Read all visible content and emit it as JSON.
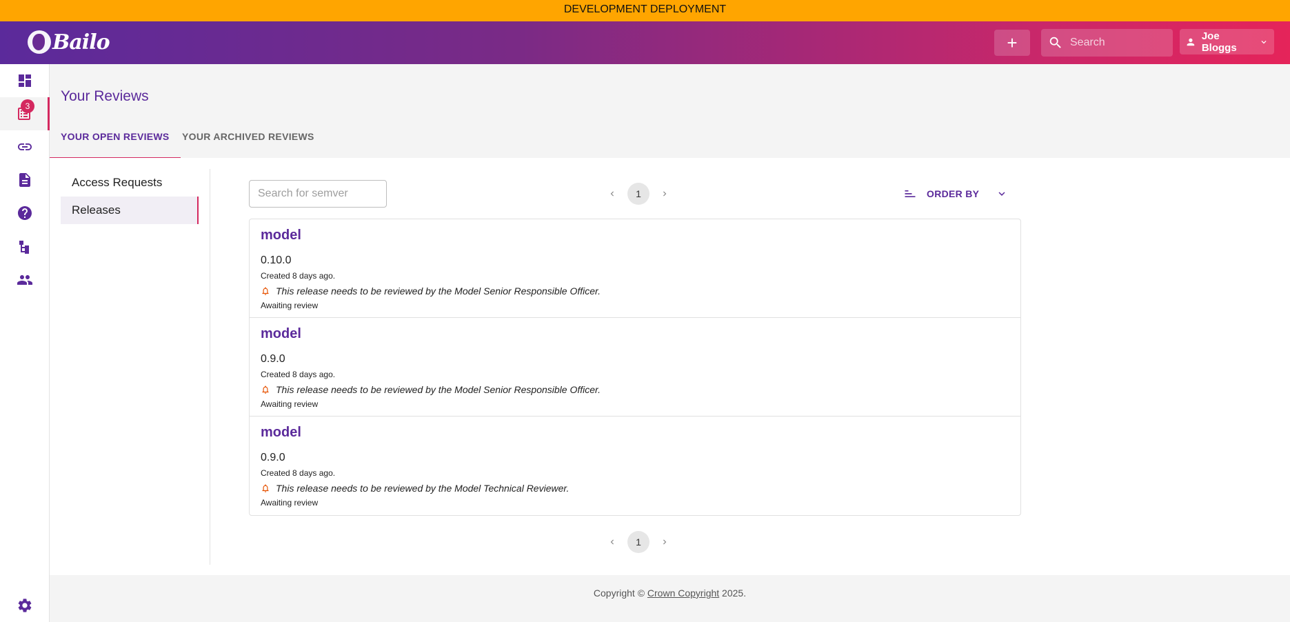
{
  "banner": {
    "text": "DEVELOPMENT DEPLOYMENT",
    "color": "#ffa500"
  },
  "brand": {
    "name": "Bailo",
    "primary": "#5b2a9b",
    "accent": "#d4285f"
  },
  "header": {
    "add_icon": "plus-icon",
    "search_placeholder": "Search",
    "user_name": "Joe Bloggs"
  },
  "sidebar": {
    "items": [
      {
        "icon": "dashboard-icon",
        "active": false
      },
      {
        "icon": "reviews-icon",
        "active": true,
        "badge": "3"
      },
      {
        "icon": "link-icon",
        "active": false
      },
      {
        "icon": "document-icon",
        "active": false
      },
      {
        "icon": "help-icon",
        "active": false
      },
      {
        "icon": "schema-icon",
        "active": false
      },
      {
        "icon": "users-icon",
        "active": false
      }
    ],
    "bottom_icon": "settings-icon"
  },
  "page": {
    "title": "Your Reviews",
    "tabs": [
      {
        "label": "YOUR OPEN REVIEWS",
        "active": true
      },
      {
        "label": "YOUR ARCHIVED REVIEWS",
        "active": false
      }
    ]
  },
  "subnav": {
    "items": [
      {
        "label": "Access Requests",
        "active": false
      },
      {
        "label": "Releases",
        "active": true
      }
    ]
  },
  "filters": {
    "semver_placeholder": "Search for semver",
    "order_by_label": "ORDER BY"
  },
  "pagination": {
    "current_page": "1"
  },
  "reviews": [
    {
      "name": "model",
      "version": "0.10.0",
      "created": "Created 8 days ago.",
      "notice": "This release needs to be reviewed by the Model Senior Responsible Officer.",
      "status": "Awaiting review"
    },
    {
      "name": "model",
      "version": "0.9.0",
      "created": "Created 8 days ago.",
      "notice": "This release needs to be reviewed by the Model Senior Responsible Officer.",
      "status": "Awaiting review"
    },
    {
      "name": "model",
      "version": "0.9.0",
      "created": "Created 8 days ago.",
      "notice": "This release needs to be reviewed by the Model Technical Reviewer.",
      "status": "Awaiting review"
    }
  ],
  "footer": {
    "prefix": "Copyright © ",
    "link": "Crown Copyright",
    "suffix": " 2025."
  }
}
